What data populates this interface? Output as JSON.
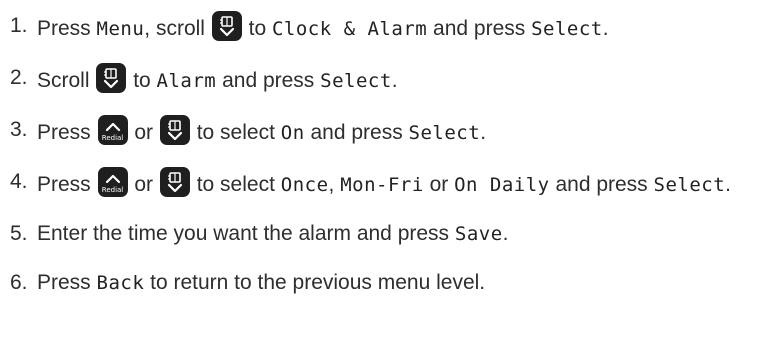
{
  "icons": {
    "scroll": "phonebook-scroll-key-icon",
    "redial": "redial-up-key-icon",
    "redial_label": "Redial"
  },
  "steps": [
    {
      "num": "1.",
      "t1": "Press ",
      "ui1": "Menu",
      "t2": ", scroll ",
      "t3": " to ",
      "ui2": "Clock & Alarm",
      "t4": " and press ",
      "ui3": "Select",
      "t5": "."
    },
    {
      "num": "2.",
      "t1": "Scroll ",
      "t2": " to ",
      "ui1": "Alarm",
      "t3": " and press ",
      "ui2": "Select",
      "t4": "."
    },
    {
      "num": "3.",
      "t1": "Press ",
      "t2": " or ",
      "t3": " to select ",
      "ui1": "On",
      "t4": " and press ",
      "ui2": "Select",
      "t5": "."
    },
    {
      "num": "4.",
      "t1": "Press ",
      "t2": " or ",
      "t3": " to select ",
      "ui1": "Once",
      "t4": ", ",
      "ui2": "Mon-Fri",
      "t5": " or ",
      "ui3": "On Daily",
      "t6": " and press ",
      "ui4": "Select",
      "t7": "."
    },
    {
      "num": "5.",
      "t1": "Enter the time you want the alarm and press ",
      "ui1": "Save",
      "t2": "."
    },
    {
      "num": "6.",
      "t1": "Press ",
      "ui1": "Back",
      "t2": " to return to the previous menu level."
    }
  ]
}
